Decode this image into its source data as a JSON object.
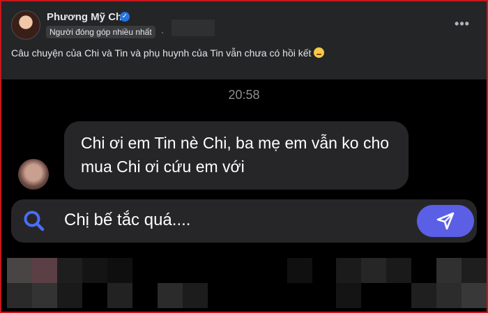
{
  "post": {
    "author_name": "Phương Mỹ Chi",
    "badge": "Người đóng góp nhiều nhất",
    "separator": "·",
    "more_glyph": "•••",
    "caption": "Câu chuyện của Chi và Tin và phụ huynh của Tin vẫn chưa có hồi kết"
  },
  "chat": {
    "timestamp": "20:58",
    "message": "Chi ơi em Tin nè Chi, ba mẹ em vẫn ko cho mua Chi ơi cứu em với",
    "input_text": "Chị bế tắc quá...."
  },
  "colors": {
    "frame_border": "#c8161d",
    "accent": "#5b5fe6",
    "search_icon": "#4a6cf7",
    "verified": "#2374e1"
  }
}
